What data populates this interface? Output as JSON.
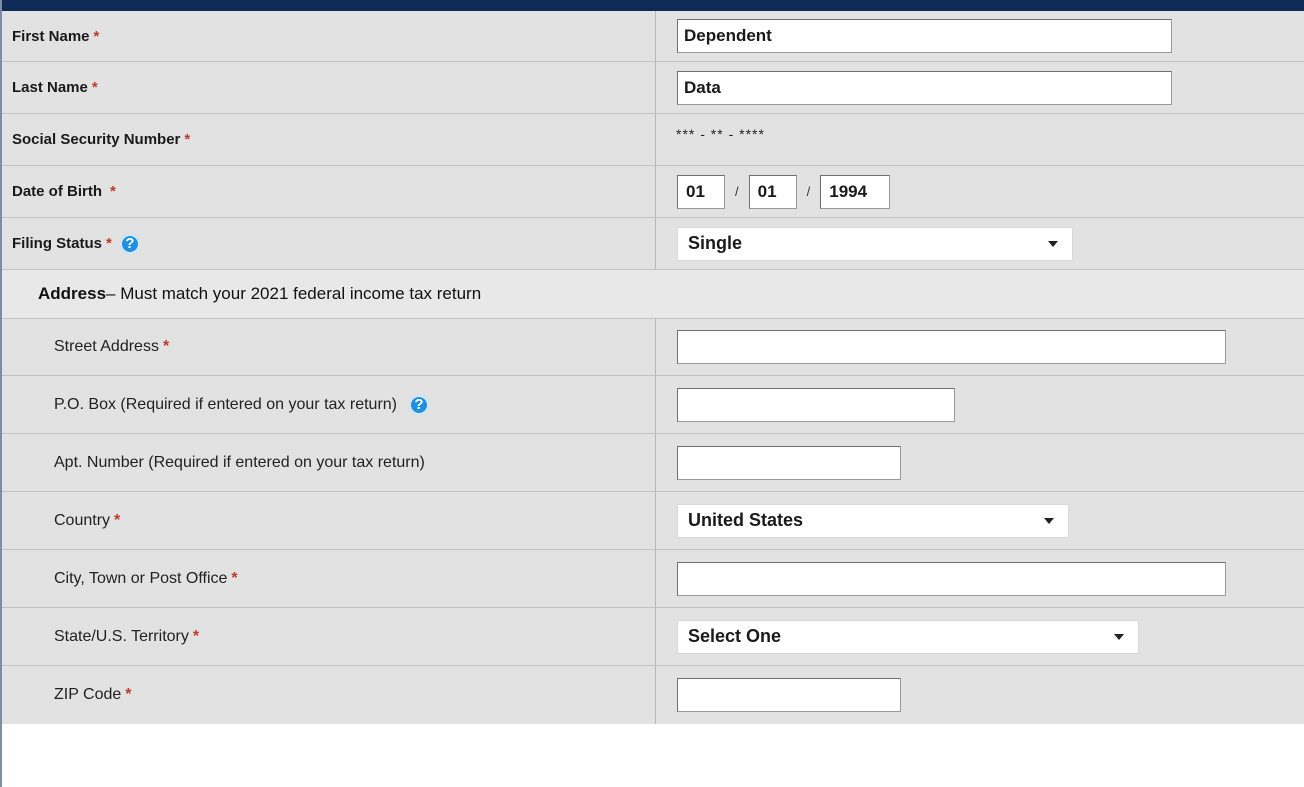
{
  "required_mark": "*",
  "help_glyph": "?",
  "fields": {
    "first_name": {
      "label": "First Name",
      "value": "Dependent"
    },
    "last_name": {
      "label": "Last Name",
      "value": "Data"
    },
    "ssn": {
      "label": "Social Security Number",
      "value": "*** - ** -   ****"
    },
    "dob": {
      "label": "Date of Birth",
      "month": "01",
      "day": "01",
      "year": "1994",
      "separator": "/"
    },
    "filing_status": {
      "label": "Filing Status",
      "value": "Single"
    }
  },
  "address_section": {
    "heading": "Address",
    "subheading": " – Must match your 2021 federal income tax return"
  },
  "address": {
    "street": {
      "label": "Street Address",
      "value": ""
    },
    "po_box": {
      "label": "P.O. Box (Required if entered on your tax return)",
      "value": ""
    },
    "apt": {
      "label": "Apt. Number (Required if entered on your tax return)",
      "value": ""
    },
    "country": {
      "label": "Country",
      "value": "United States"
    },
    "city": {
      "label": "City, Town or Post Office",
      "value": ""
    },
    "state": {
      "label": "State/U.S. Territory",
      "value": "Select One"
    },
    "zip": {
      "label": "ZIP Code",
      "value": ""
    }
  },
  "colors": {
    "top_bar": "#0f2a57",
    "row_background": "#e2e2e2",
    "required": "#c0392b",
    "help_icon": "#1f8fe0"
  }
}
